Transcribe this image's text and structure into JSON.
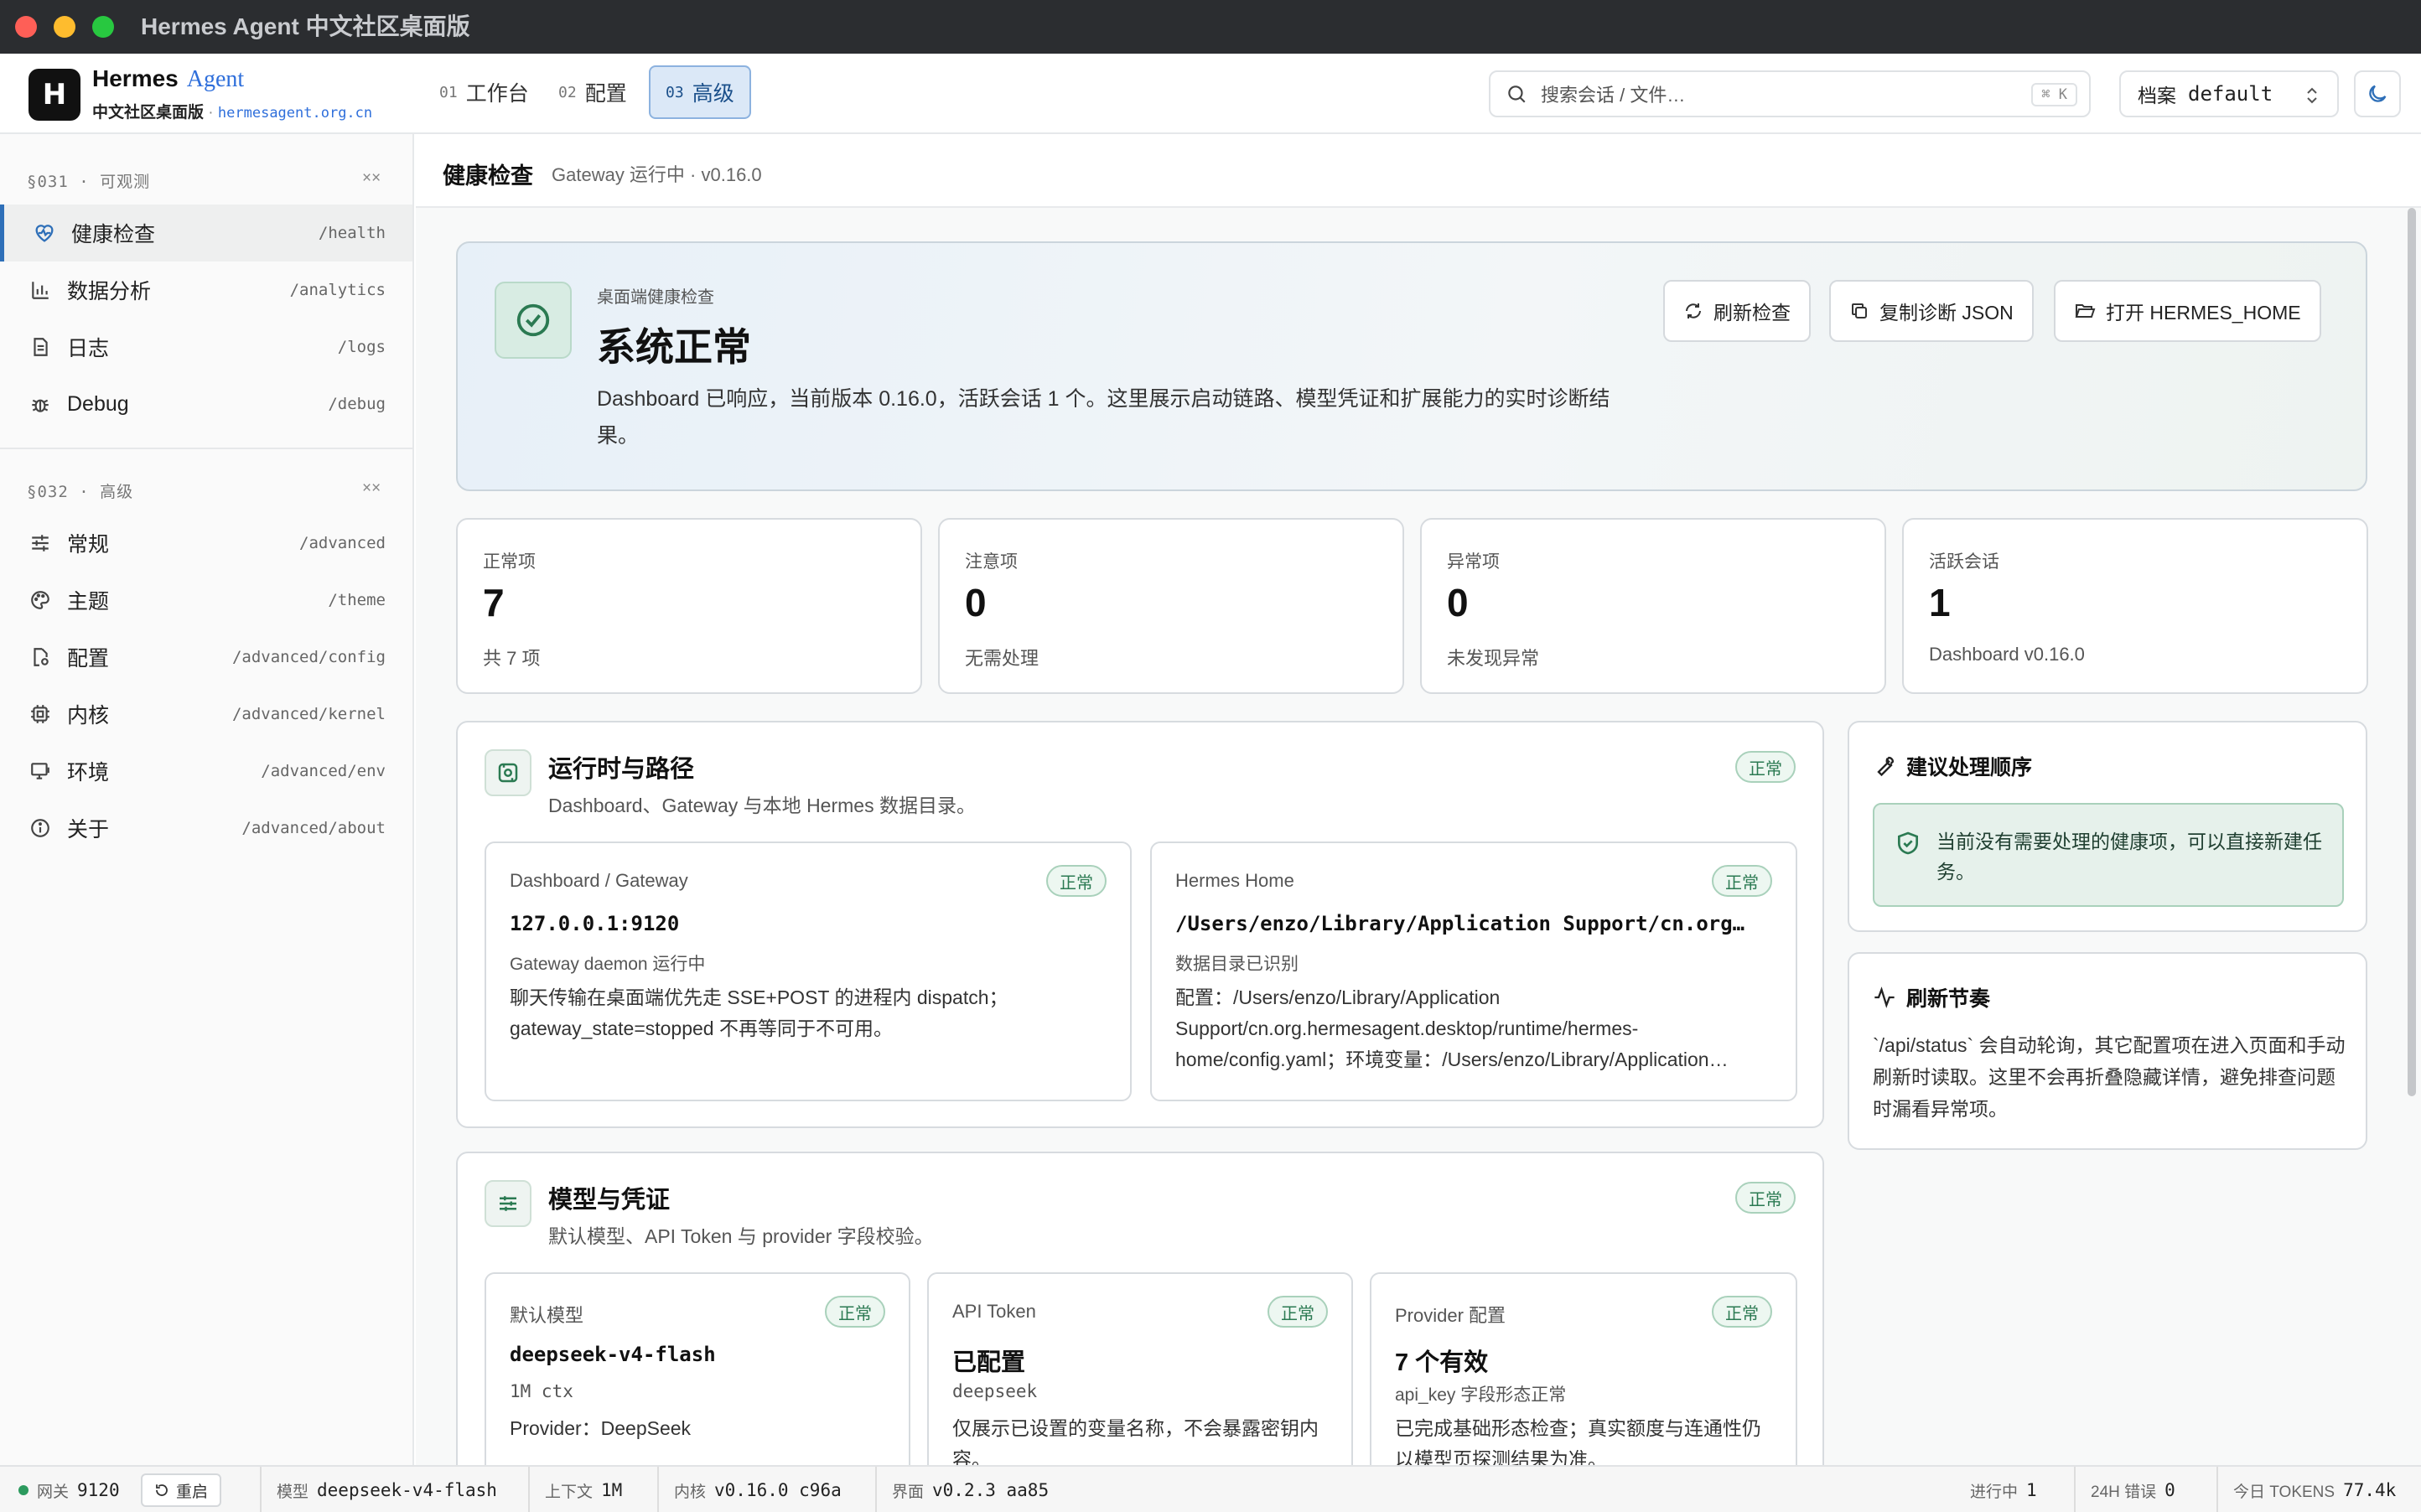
{
  "window": {
    "title": "Hermes Agent 中文社区桌面版"
  },
  "brand": {
    "name": "Hermes",
    "agent": "Agent",
    "subtitle": "中文社区桌面版",
    "separator": "·",
    "domain": "hermesagent.org.cn",
    "logo_letter": "H"
  },
  "nav": {
    "tabs": [
      {
        "num": "01",
        "label": "工作台"
      },
      {
        "num": "02",
        "label": "配置"
      },
      {
        "num": "03",
        "label": "高级",
        "active": true
      }
    ]
  },
  "search": {
    "placeholder": "搜索会话 / 文件…",
    "shortcut": "⌘ K"
  },
  "profile": {
    "label": "档案",
    "value": "default"
  },
  "sidebar": {
    "sections": [
      {
        "head": "§031 · 可观测",
        "collapse": "××",
        "items": [
          {
            "label": "健康检查",
            "path": "/health",
            "icon": "heart-pulse-icon",
            "active": true
          },
          {
            "label": "数据分析",
            "path": "/analytics",
            "icon": "bar-chart-icon"
          },
          {
            "label": "日志",
            "path": "/logs",
            "icon": "file-text-icon"
          },
          {
            "label": "Debug",
            "path": "/debug",
            "icon": "bug-icon"
          }
        ]
      },
      {
        "head": "§032 · 高级",
        "collapse": "××",
        "items": [
          {
            "label": "常规",
            "path": "/advanced",
            "icon": "sliders-icon"
          },
          {
            "label": "主题",
            "path": "/theme",
            "icon": "palette-icon"
          },
          {
            "label": "配置",
            "path": "/advanced/config",
            "icon": "file-cog-icon"
          },
          {
            "label": "内核",
            "path": "/advanced/kernel",
            "icon": "cpu-icon"
          },
          {
            "label": "环境",
            "path": "/advanced/env",
            "icon": "monitor-icon"
          },
          {
            "label": "关于",
            "path": "/advanced/about",
            "icon": "info-icon"
          }
        ]
      }
    ]
  },
  "main": {
    "title": "健康检查",
    "subtitle": "Gateway 运行中 · v0.16.0",
    "hero": {
      "kicker": "桌面端健康检查",
      "status": "系统正常",
      "desc": "Dashboard 已响应，当前版本 0.16.0，活跃会话 1 个。这里展示启动链路、模型凭证和扩展能力的实时诊断结果。",
      "buttons": [
        "刷新检查",
        "复制诊断 JSON",
        "打开 HERMES_HOME"
      ]
    },
    "stats": [
      {
        "label": "正常项",
        "value": "7",
        "note": "共 7 项"
      },
      {
        "label": "注意项",
        "value": "0",
        "note": "无需处理"
      },
      {
        "label": "异常项",
        "value": "0",
        "note": "未发现异常"
      },
      {
        "label": "活跃会话",
        "value": "1",
        "note": "Dashboard v0.16.0"
      }
    ],
    "runtime": {
      "title": "运行时与路径",
      "subtitle": "Dashboard、Gateway 与本地 Hermes 数据目录。",
      "badge": "正常",
      "items": [
        {
          "label": "Dashboard / Gateway",
          "badge": "正常",
          "value": "127.0.0.1:9120",
          "meta": "Gateway daemon 运行中",
          "desc": "聊天传输在桌面端优先走 SSE+POST 的进程内 dispatch；gateway_state=stopped 不再等同于不可用。"
        },
        {
          "label": "Hermes Home",
          "badge": "正常",
          "value": "/Users/enzo/Library/Application Support/cn.org…",
          "meta": "数据目录已识别",
          "desc": "配置：/Users/enzo/Library/Application Support/cn.org.hermesagent.desktop/runtime/hermes-home/config.yaml；环境变量：/Users/enzo/Library/Application…"
        }
      ]
    },
    "model": {
      "title": "模型与凭证",
      "subtitle": "默认模型、API Token 与 provider 字段校验。",
      "badge": "正常",
      "items": [
        {
          "label": "默认模型",
          "badge": "正常",
          "value": "deepseek-v4-flash",
          "meta": "1M ctx",
          "desc": "Provider：DeepSeek"
        },
        {
          "label": "API Token",
          "badge": "正常",
          "value": "已配置",
          "meta": "deepseek",
          "desc": "仅展示已设置的变量名称，不会暴露密钥内容。"
        },
        {
          "label": "Provider 配置",
          "badge": "正常",
          "value": "7 个有效",
          "meta": "api_key 字段形态正常",
          "desc": "已完成基础形态检查；真实额度与连通性仍以模型页探测结果为准。"
        }
      ]
    },
    "advice": {
      "title": "建议处理顺序",
      "text": "当前没有需要处理的健康项，可以直接新建任务。"
    },
    "refresh": {
      "title": "刷新节奏",
      "text": "`/api/status` 会自动轮询，其它配置项在进入页面和手动刷新时读取。这里不会再折叠隐藏详情，避免排查问题时漏看异常项。"
    }
  },
  "statusbar": {
    "gateway_label": "网关",
    "gateway_value": "9120",
    "restart": "重启",
    "model_label": "模型",
    "model_value": "deepseek-v4-flash",
    "ctx_label": "上下文",
    "ctx_value": "1M",
    "kernel_label": "内核",
    "kernel_value": "v0.16.0 c96a",
    "ui_label": "界面",
    "ui_value": "v0.2.3 aa85",
    "running_label": "进行中",
    "running_value": "1",
    "err_label": "24H 错误",
    "err_value": "0",
    "tokens_label": "今日 TOKENS",
    "tokens_value": "77.4k"
  },
  "colors": {
    "accent": "#2e6fb8",
    "ok": "#2b7a52",
    "titlebar": "#2b2d30"
  }
}
